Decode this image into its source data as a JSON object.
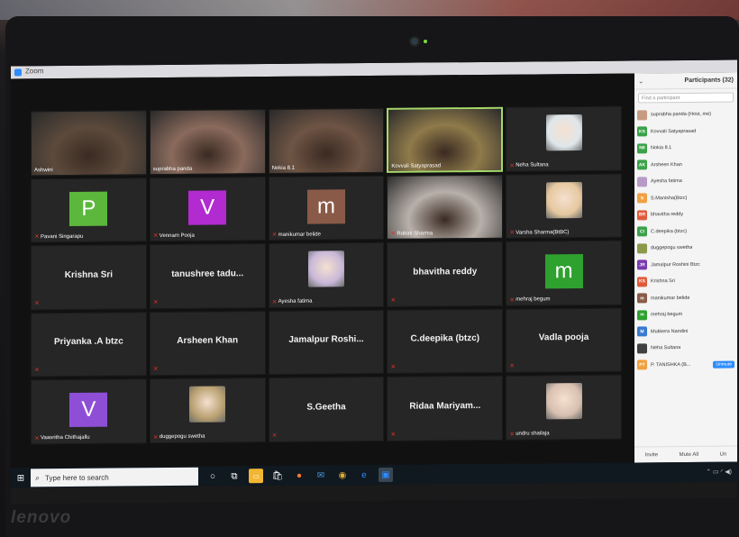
{
  "window": {
    "title": "Zoom"
  },
  "tiles": [
    {
      "name": "Ashwini",
      "kind": "video",
      "muted": false,
      "bg": "#5c4a3c"
    },
    {
      "name": "suprabha panda",
      "kind": "video",
      "muted": false,
      "bg": "#8a6a5c"
    },
    {
      "name": "Nokia 8.1",
      "kind": "video",
      "muted": false,
      "bg": "#6e5444"
    },
    {
      "name": "Kovvali Satyaprasad",
      "kind": "video",
      "muted": false,
      "bg": "#8f7a4a",
      "active": true
    },
    {
      "name": "Neha Sultana",
      "kind": "photo",
      "muted": true,
      "bg": "#dfe6ea"
    },
    {
      "name": "Pavani Singarapu",
      "kind": "avatar",
      "letter": "P",
      "color": "#5cb83c",
      "muted": true
    },
    {
      "name": "Vennam Pooja",
      "kind": "avatar",
      "letter": "V",
      "color": "#b12bd0",
      "muted": true
    },
    {
      "name": "manikumar belide",
      "kind": "avatar",
      "letter": "m",
      "color": "#8a5a48",
      "muted": true
    },
    {
      "name": "Rohini Sharma",
      "kind": "video",
      "muted": true,
      "bg": "#b8b0aa"
    },
    {
      "name": "Varsha Sharma(BtBC)",
      "kind": "photo",
      "muted": true,
      "bg": "#e6c8a0"
    },
    {
      "big": "Krishna Sri",
      "kind": "text",
      "muted": true
    },
    {
      "big": "tanushree tadu...",
      "kind": "text",
      "muted": true
    },
    {
      "name": "Ayesha fatima",
      "kind": "photo",
      "muted": true,
      "bg": "#c8b8d8"
    },
    {
      "big": "bhavitha reddy",
      "kind": "text",
      "muted": true
    },
    {
      "name": "mehraj begum",
      "kind": "avatar",
      "letter": "m",
      "color": "#2ea12e",
      "muted": true
    },
    {
      "big": "Priyanka .A btzc",
      "kind": "text",
      "muted": true
    },
    {
      "big": "Arsheen Khan",
      "kind": "text",
      "muted": true
    },
    {
      "big": "Jamalpur Roshi...",
      "kind": "text",
      "muted": false
    },
    {
      "big": "C.deepika (btzc)",
      "kind": "text",
      "muted": true
    },
    {
      "big": "Vadla pooja",
      "kind": "text",
      "muted": true
    },
    {
      "name": "Vaasritha Chithajallu",
      "kind": "avatar",
      "letter": "V",
      "color": "#8e4fd6",
      "muted": true
    },
    {
      "name": "duggepogu swetha",
      "kind": "photo",
      "muted": true,
      "bg": "#b8a070"
    },
    {
      "big": "S.Geetha",
      "kind": "text",
      "muted": true
    },
    {
      "big": "Ridaa Mariyam...",
      "kind": "text",
      "muted": true
    },
    {
      "name": "undru shailaja",
      "kind": "photo",
      "muted": true,
      "bg": "#d8c0b0"
    }
  ],
  "participants_panel": {
    "title": "Participants (32)",
    "search_placeholder": "Find a participant",
    "items": [
      {
        "initials": "",
        "name": "suprabha panda (Host, me)",
        "color": "#c89a80"
      },
      {
        "initials": "KS",
        "name": "Kovvali Satyaprasad",
        "color": "#3aa14a"
      },
      {
        "initials": "N8",
        "name": "Nokia 8.1",
        "color": "#3aa14a"
      },
      {
        "initials": "AK",
        "name": "Arsheen Khan",
        "color": "#3aa14a"
      },
      {
        "initials": "",
        "name": "Ayesha fatima",
        "color": "#b89ac8"
      },
      {
        "initials": "S",
        "name": "S.Manisha(Btzc)",
        "color": "#f0a040"
      },
      {
        "initials": "BR",
        "name": "bhavitha reddy",
        "color": "#e05a3a"
      },
      {
        "initials": "CI",
        "name": "C.deepika (btzc)",
        "color": "#3aa14a"
      },
      {
        "initials": "",
        "name": "duggepogu swetha",
        "color": "#8a9a4a"
      },
      {
        "initials": "JR",
        "name": "Jamalpur Roshini Btzc",
        "color": "#7a3ab0"
      },
      {
        "initials": "KS",
        "name": "Krishna Sri",
        "color": "#e05a3a"
      },
      {
        "initials": "m",
        "name": "manikumar belide",
        "color": "#8a5a48"
      },
      {
        "initials": "m",
        "name": "mehraj begum",
        "color": "#2ea12e"
      },
      {
        "initials": "M",
        "name": "Mukkera Nandini",
        "color": "#3a7ad0"
      },
      {
        "initials": "",
        "name": "Neha Sultana",
        "color": "#404040"
      },
      {
        "initials": "PT",
        "name": "P. TANISHKA (B...",
        "color": "#f0a040",
        "action": "Unmute"
      }
    ],
    "footer": {
      "invite": "Invite",
      "mute_all": "Mute All",
      "more": "Un"
    }
  },
  "taskbar": {
    "search_placeholder": "Type here to search"
  },
  "brand": "lenovo"
}
